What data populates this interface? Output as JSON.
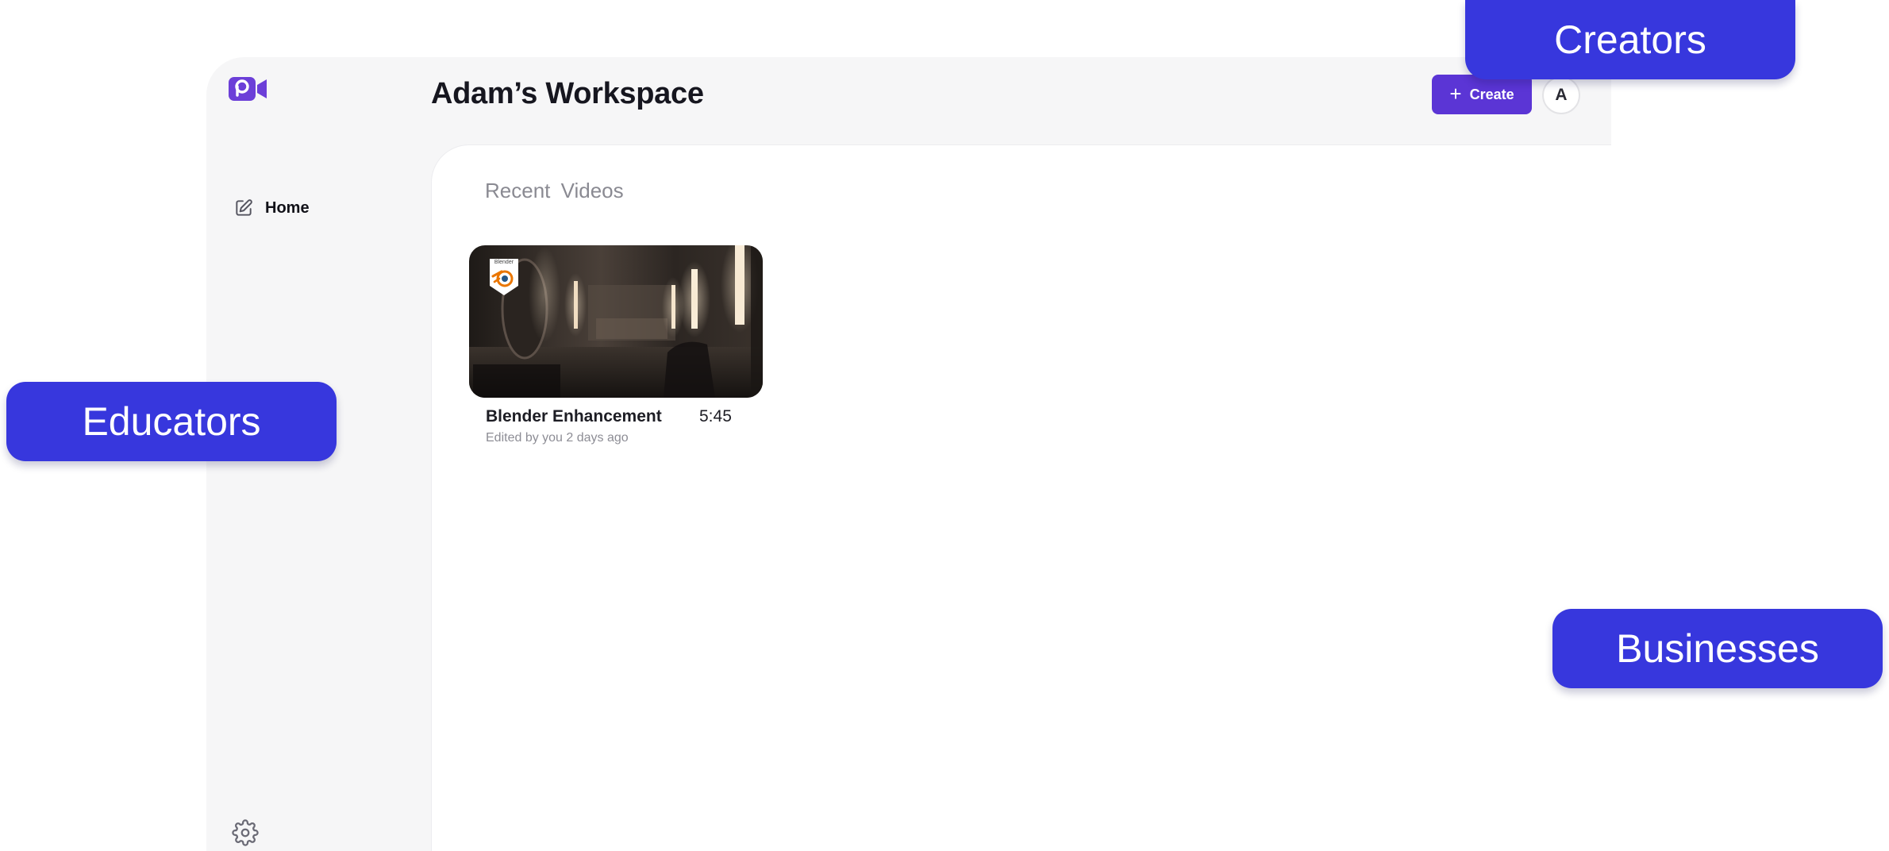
{
  "header": {
    "workspace_title": "Adam’s Workspace",
    "create_label": "Create",
    "avatar_initial": "A"
  },
  "sidebar": {
    "items": [
      {
        "label": "Home",
        "icon": "edit-icon"
      }
    ],
    "settings_icon": "gear-icon"
  },
  "main": {
    "section_title": "Recent  Videos",
    "videos": [
      {
        "title": "Blender Enhancement",
        "duration": "5:45",
        "meta": "Edited by you 2 days ago",
        "badge_text": "Blender"
      }
    ]
  },
  "labels": {
    "creators": "Creators",
    "educators": "Educators",
    "businesses": "Businesses"
  },
  "colors": {
    "accent": "#5b35d5",
    "label_bg": "#3737dd",
    "logo": "#6c3fd8"
  }
}
